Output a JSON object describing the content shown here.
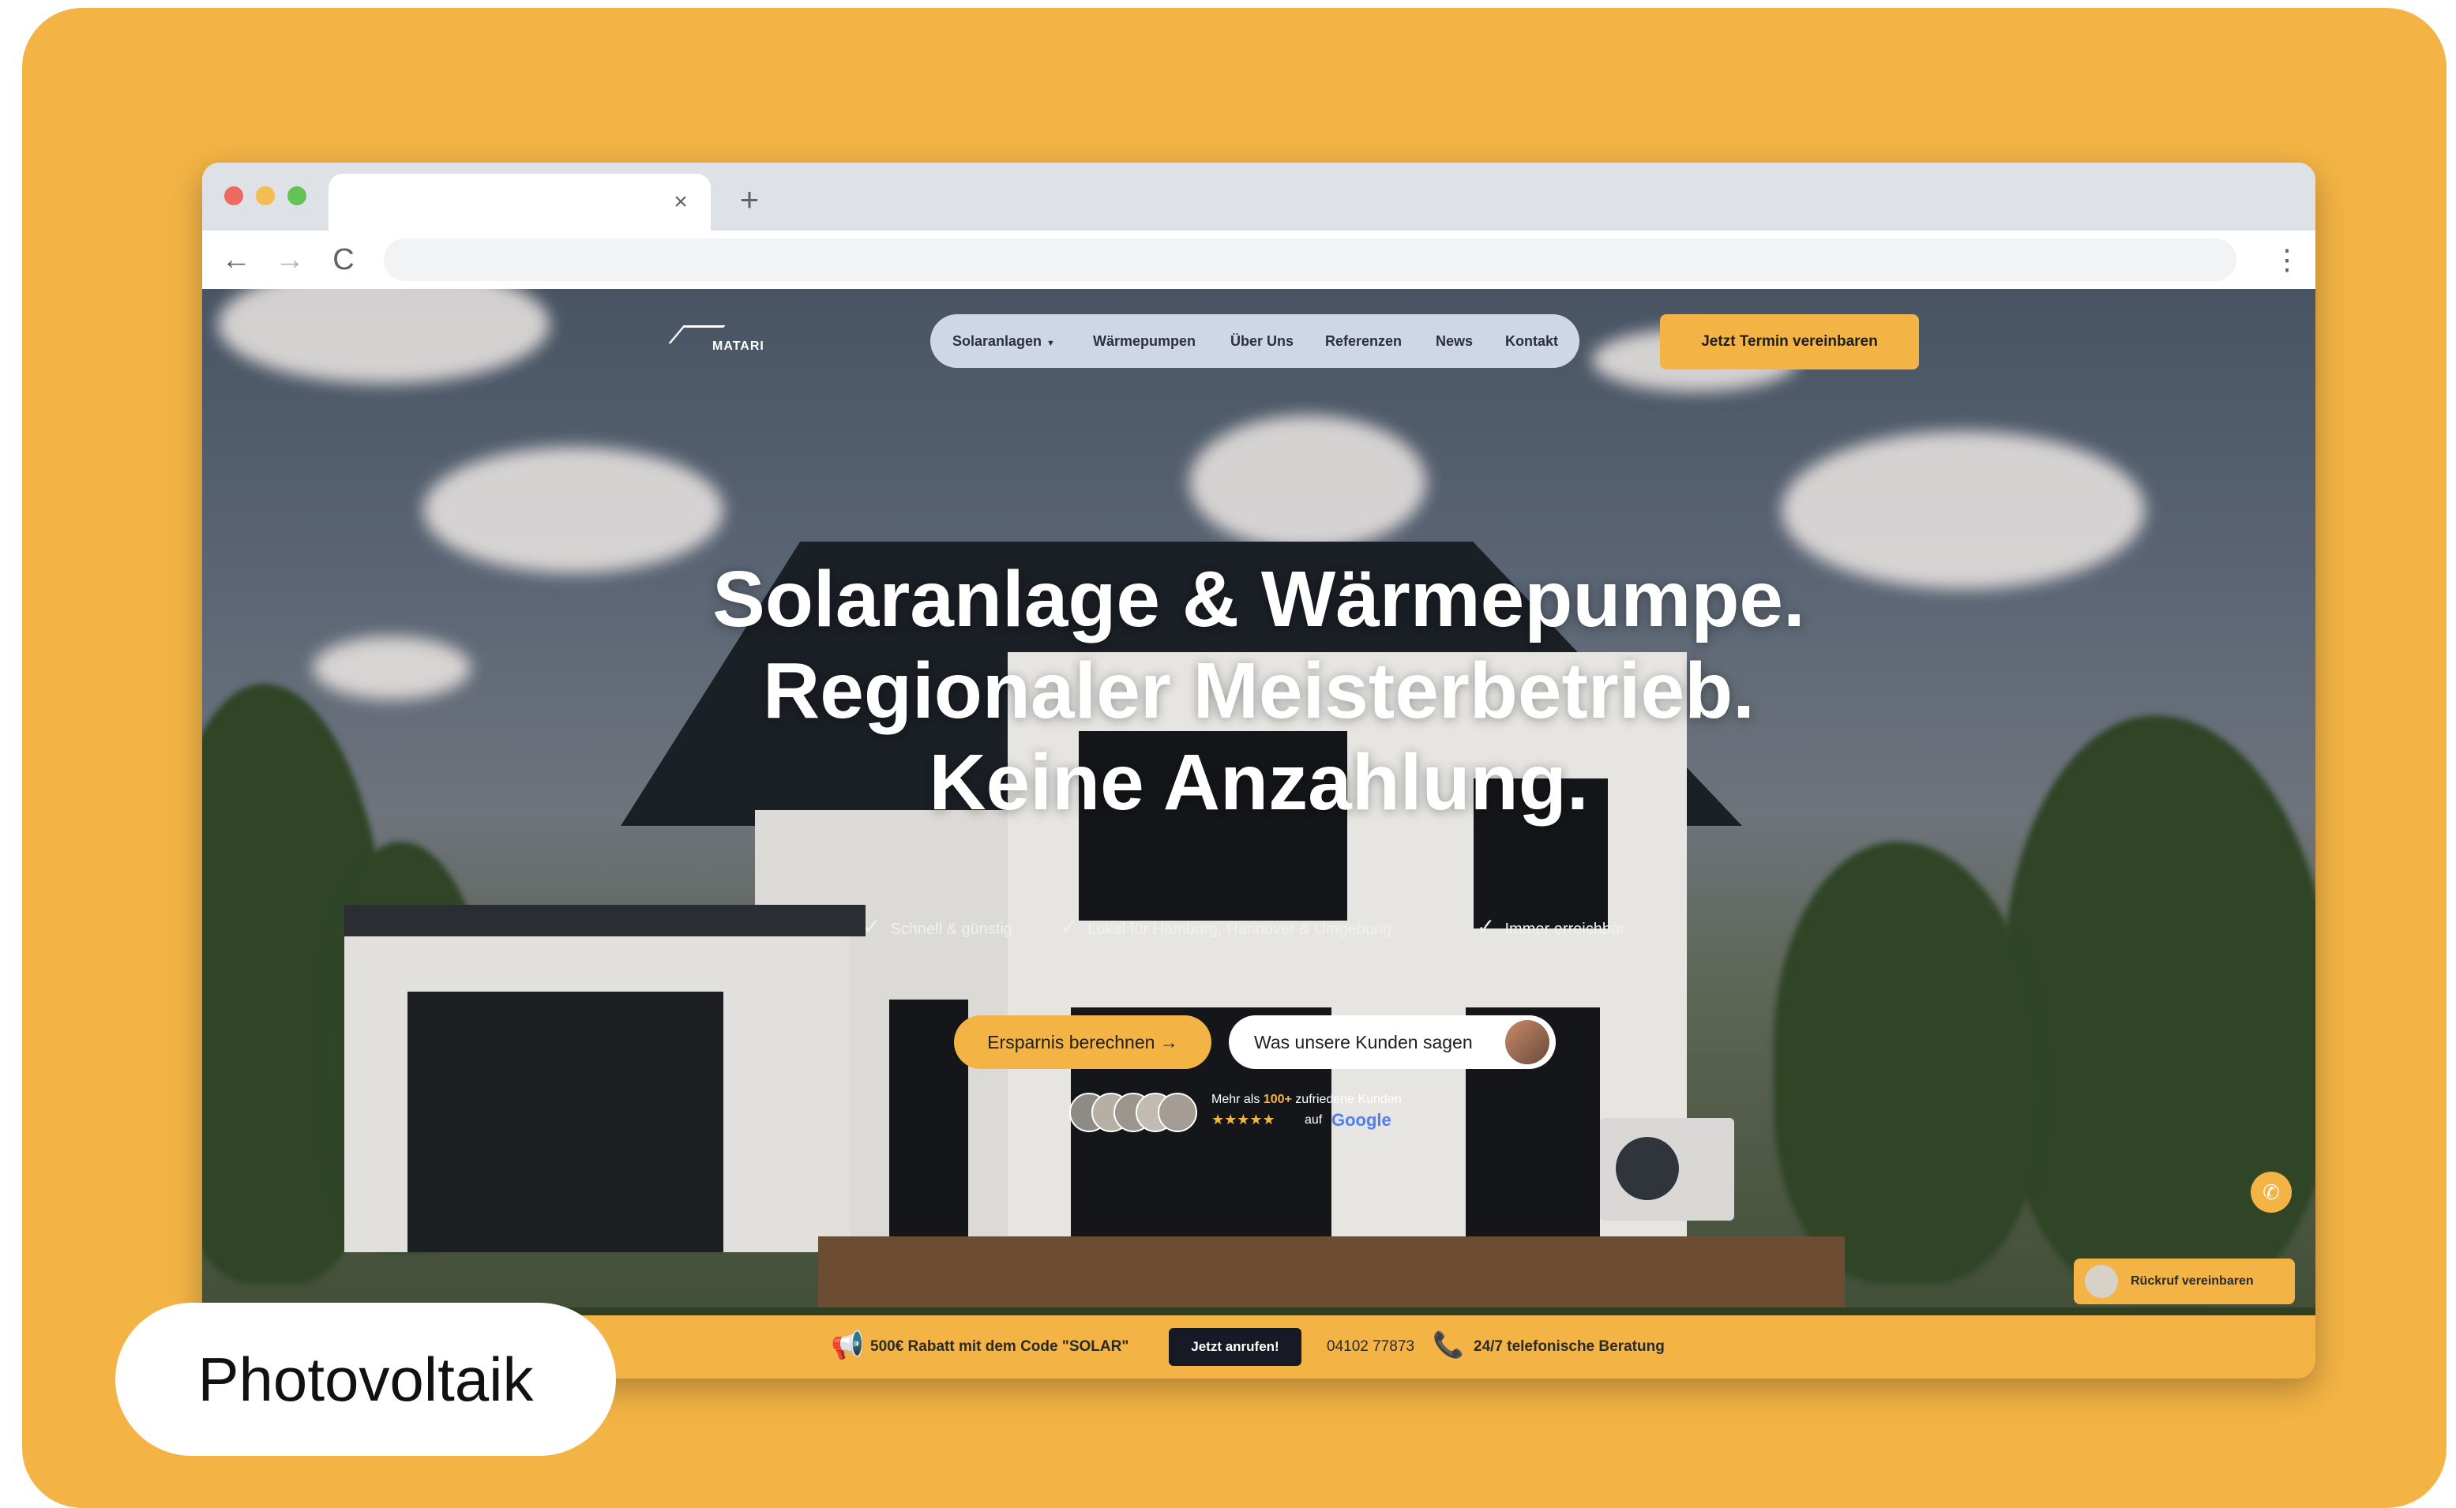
{
  "browser": {
    "tab_close_glyph": "×",
    "new_tab_glyph": "+",
    "back_glyph": "←",
    "forward_glyph": "→",
    "reload_glyph": "C",
    "menu_glyph": "⋮"
  },
  "site": {
    "logo_text": "MATARI",
    "nav": {
      "items": [
        {
          "label": "Solaranlagen",
          "has_dropdown": true
        },
        {
          "label": "Wärmepumpen"
        },
        {
          "label": "Über Uns"
        },
        {
          "label": "Referenzen"
        },
        {
          "label": "News"
        },
        {
          "label": "Kontakt"
        }
      ],
      "dropdown_glyph": "▼"
    },
    "cta_top": "Jetzt Termin vereinbaren",
    "hero": {
      "line1": "Solaranlage & Wärmepumpe.",
      "line2": "Regionaler Meisterbetrieb.",
      "line3_highlight": "Keine",
      "line3_rest": " Anzahlung."
    },
    "features": [
      "Schnell & günstig",
      "Lokal für Hamburg, Hannover & Umgebung",
      "Immer erreichbar"
    ],
    "check_glyph": "✓",
    "btn_primary": "Ersparnis berechnen →",
    "btn_secondary": "Was unsere Kunden sagen",
    "rating": {
      "prefix": "Mehr als ",
      "count": "100+",
      "suffix": " zufriedene Kunden",
      "stars": "★★★★★",
      "auf": "auf",
      "platform": "Google"
    },
    "whatsapp_glyph": "✆",
    "callback": "Rückruf vereinbaren",
    "promo": {
      "icon": "📢",
      "text": "500€ Rabatt mit dem Code \"SOLAR\"",
      "button": "Jetzt anrufen!",
      "phone": "04102 77873",
      "phone_icon": "📞",
      "support": "24/7 telefonische Beratung"
    }
  },
  "label": "Photovoltaik",
  "colors": {
    "accent": "#F3B345",
    "dark_button": "#171a24",
    "nav_pill": "#cfd6e6"
  }
}
